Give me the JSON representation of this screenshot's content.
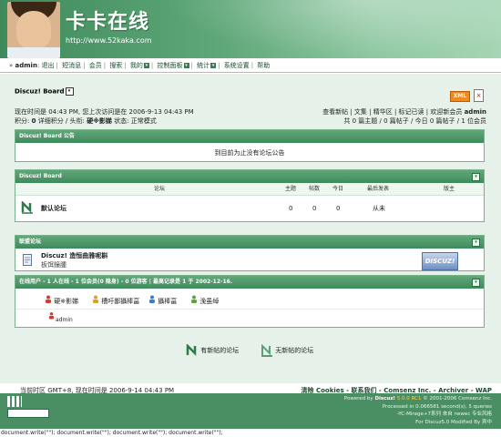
{
  "banner": {
    "title": "卡卡在线",
    "url": "http://www.52kaka.com"
  },
  "nav": {
    "user_prefix": "» ",
    "user": "admin",
    "user_suffix": ":",
    "items": [
      "退出",
      "短消息",
      "会员",
      "搜索",
      "我的",
      "控制面板",
      "统计",
      "系统设置",
      "帮助"
    ]
  },
  "breadcrumb": "Discuz! Board",
  "xml_label": "XML",
  "close_label": "×",
  "info_left": {
    "line1": "现在时间是 04:43 PM, 您上次访问是在 2006-9-13 04:43 PM",
    "line2_prefix": "积分: ",
    "points": "0",
    "line2_mid": " 详细积分 / 头衔: ",
    "title": "硬※影娣",
    "line2_status": " 状态: 正常模式"
  },
  "info_right": {
    "line1": "查看新帖 | 文集 | 精华区 | 标记已读 | 欢迎新会员 ",
    "newest_member": "admin",
    "line2": "共 0 篇主题 / 0 篇帖子 / 今日 0 篇帖子 / 1 位会员"
  },
  "announce": {
    "header": "Discuz! Board 公告",
    "body": "到目前为止没有论坛公告"
  },
  "forums": {
    "header": "Discuz! Board",
    "columns": {
      "forum": "论坛",
      "topics": "主题",
      "posts": "帖数",
      "today": "今日",
      "lastpost": "最后发表",
      "moderator": "版主"
    },
    "rows": [
      {
        "name": "默认论坛",
        "topics": "0",
        "posts": "0",
        "today": "0",
        "lastpost": "从未",
        "moderator": ""
      }
    ]
  },
  "links": {
    "header": "联盟论坛",
    "items": [
      {
        "name": "Discuz! 造恒曲雅呢斟",
        "desc": "板饵鐘腫",
        "badge": "DISCUZ!"
      }
    ]
  },
  "online": {
    "header_parts": [
      {
        "t": "在线用户 - ",
        "b": false
      },
      {
        "t": "1",
        "b": true
      },
      {
        "t": " 人在线 - ",
        "b": false
      },
      {
        "t": "1",
        "b": true
      },
      {
        "t": " 位会员(",
        "b": false
      },
      {
        "t": "0",
        "b": true
      },
      {
        "t": " 隐身) - ",
        "b": false
      },
      {
        "t": "0",
        "b": true
      },
      {
        "t": " 位游客 | 最高记录是 ",
        "b": false
      },
      {
        "t": "1",
        "b": true
      },
      {
        "t": " 于 ",
        "b": false
      },
      {
        "t": "2002-12-16",
        "b": true
      },
      {
        "t": ".",
        "b": false
      }
    ],
    "legend": [
      "硬※影娣",
      "槽吁鄙攝棒畗",
      "攝棒畗",
      "浼虽绰"
    ],
    "legend_colors": [
      "#d93a2b",
      "#e0a020",
      "#3a7ad9",
      "#5aa63a"
    ],
    "users": [
      "admin"
    ]
  },
  "forum_legend": {
    "new": "有新帖的论坛",
    "nonew": "无新帖的论坛"
  },
  "footer": {
    "time_prefix": "当前时区 GMT+8, 现在时间是 ",
    "time": "2006-9-14 04:43 PM",
    "links": "清除 Cookies - 联系我们 - Comsenz Inc. - Archiver - WAP",
    "powered_line1_prefix": "Powered by ",
    "powered_brand": "Discuz!",
    "powered_version": "5.0.0 RC1",
    "powered_line1_suffix": " © 2001-2006 Comsenz Inc.",
    "powered_line2": "Processed in 0.066581 second(s), 5 queries",
    "powered_line3": "-YC-Mirage+7系列 來自 newec 专业风格",
    "powered_line4": "For Discuz5.0 Modified By 宾中"
  },
  "docwrite": "document.write(\"\"); document.write(\"\"); document.write(\"\"); document.write(\"\");"
}
